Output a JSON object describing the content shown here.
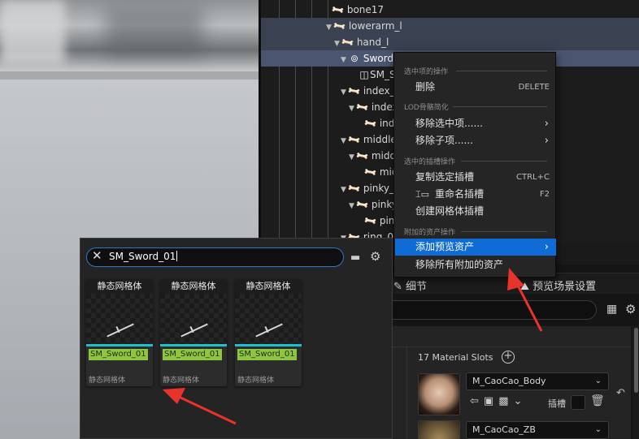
{
  "tree": {
    "rows": [
      {
        "label": "bone17",
        "kind": "bone"
      },
      {
        "label": "lowerarm_l",
        "kind": "bone"
      },
      {
        "label": "hand_l",
        "kind": "bone"
      },
      {
        "label": "Sword_",
        "kind": "socket"
      },
      {
        "label": "SM_S",
        "kind": "mesh"
      },
      {
        "label": "index_",
        "kind": "bone"
      },
      {
        "label": "index",
        "kind": "bone"
      },
      {
        "label": "ind",
        "kind": "bone"
      },
      {
        "label": "middle",
        "kind": "bone"
      },
      {
        "label": "midd",
        "kind": "bone"
      },
      {
        "label": "mid",
        "kind": "bone"
      },
      {
        "label": "pinky_",
        "kind": "bone"
      },
      {
        "label": "pinky",
        "kind": "bone"
      },
      {
        "label": "pin",
        "kind": "bone"
      },
      {
        "label": "ring_0",
        "kind": "bone"
      }
    ]
  },
  "context_menu": {
    "sections": [
      {
        "header": "选中项的操作",
        "items": [
          {
            "label": "删除",
            "shortcut": "DELETE"
          }
        ]
      },
      {
        "header": "LOD骨骼简化",
        "items": [
          {
            "label": "移除选中项......",
            "submenu": true
          },
          {
            "label": "移除子项......",
            "submenu": true
          }
        ]
      },
      {
        "header": "选中的插槽操作",
        "items": [
          {
            "label": "复制选定插槽",
            "shortcut": "CTRL+C"
          },
          {
            "label": "重命名插槽",
            "shortcut": "F2",
            "icon": "rename-icon"
          },
          {
            "label": "创建网格体插槽"
          }
        ]
      },
      {
        "header": "附加的资产操作",
        "items": [
          {
            "label": "添加预览资产",
            "submenu": true,
            "highlighted": true
          },
          {
            "label": "移除所有附加的资产"
          }
        ]
      }
    ]
  },
  "details": {
    "tab_details": "细节",
    "tab_scene": "预览场景设置",
    "slots_label": "17 Material Slots",
    "materials": [
      "M_CaoCao_Body",
      "M_CaoCao_ZB"
    ],
    "slot_label": "插槽"
  },
  "picker": {
    "search_value": "SM_Sword_01",
    "tiles": [
      {
        "title": "静态网格体",
        "name": "SM_Sword_01",
        "type": "静态网格体"
      },
      {
        "title": "静态网格体",
        "name": "SM_Sword_01",
        "type": "静态网格体"
      },
      {
        "title": "静态网格体",
        "name": "SM_Sword_01",
        "type": "静态网格体"
      }
    ]
  },
  "colors": {
    "highlight": "#0f6bd6",
    "annotation_arrow": "#e8332b",
    "name_highlight": "#8fc63f",
    "accent_bar": "#1fbfd0"
  }
}
